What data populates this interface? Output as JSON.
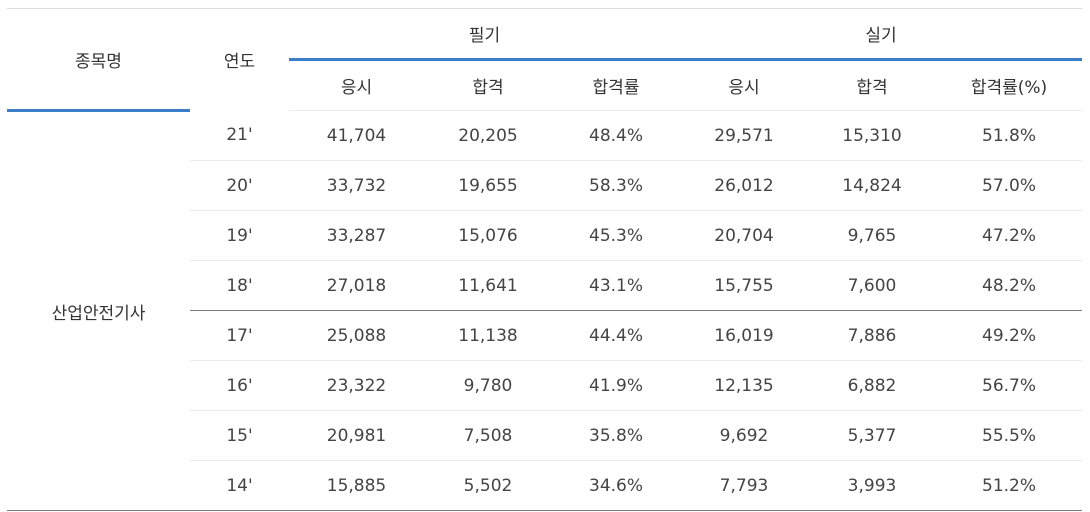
{
  "header": {
    "col_name": "종목명",
    "col_year": "연도",
    "group_written": "필기",
    "group_practical": "실기",
    "sub": [
      "응시",
      "합격",
      "합격률",
      "응시",
      "합격",
      "합격률(%)"
    ]
  },
  "category": "산업안전기사",
  "rows": [
    {
      "year": "21'",
      "cells": [
        "41,704",
        "20,205",
        "48.4%",
        "29,571",
        "15,310",
        "51.8%"
      ]
    },
    {
      "year": "20'",
      "cells": [
        "33,732",
        "19,655",
        "58.3%",
        "26,012",
        "14,824",
        "57.0%"
      ]
    },
    {
      "year": "19'",
      "cells": [
        "33,287",
        "15,076",
        "45.3%",
        "20,704",
        "9,765",
        "47.2%"
      ]
    },
    {
      "year": "18'",
      "cells": [
        "27,018",
        "11,641",
        "43.1%",
        "15,755",
        "7,600",
        "48.2%"
      ]
    },
    {
      "year": "17'",
      "cells": [
        "25,088",
        "11,138",
        "44.4%",
        "16,019",
        "7,886",
        "49.2%"
      ]
    },
    {
      "year": "16'",
      "cells": [
        "23,322",
        "9,780",
        "41.9%",
        "12,135",
        "6,882",
        "56.7%"
      ]
    },
    {
      "year": "15'",
      "cells": [
        "20,981",
        "7,508",
        "35.8%",
        "9,692",
        "5,377",
        "55.5%"
      ]
    },
    {
      "year": "14'",
      "cells": [
        "15,885",
        "5,502",
        "34.6%",
        "7,793",
        "3,993",
        "51.2%"
      ]
    }
  ],
  "colors": {
    "accent": "#3a7dc9",
    "divider": "#7a7a7a"
  }
}
